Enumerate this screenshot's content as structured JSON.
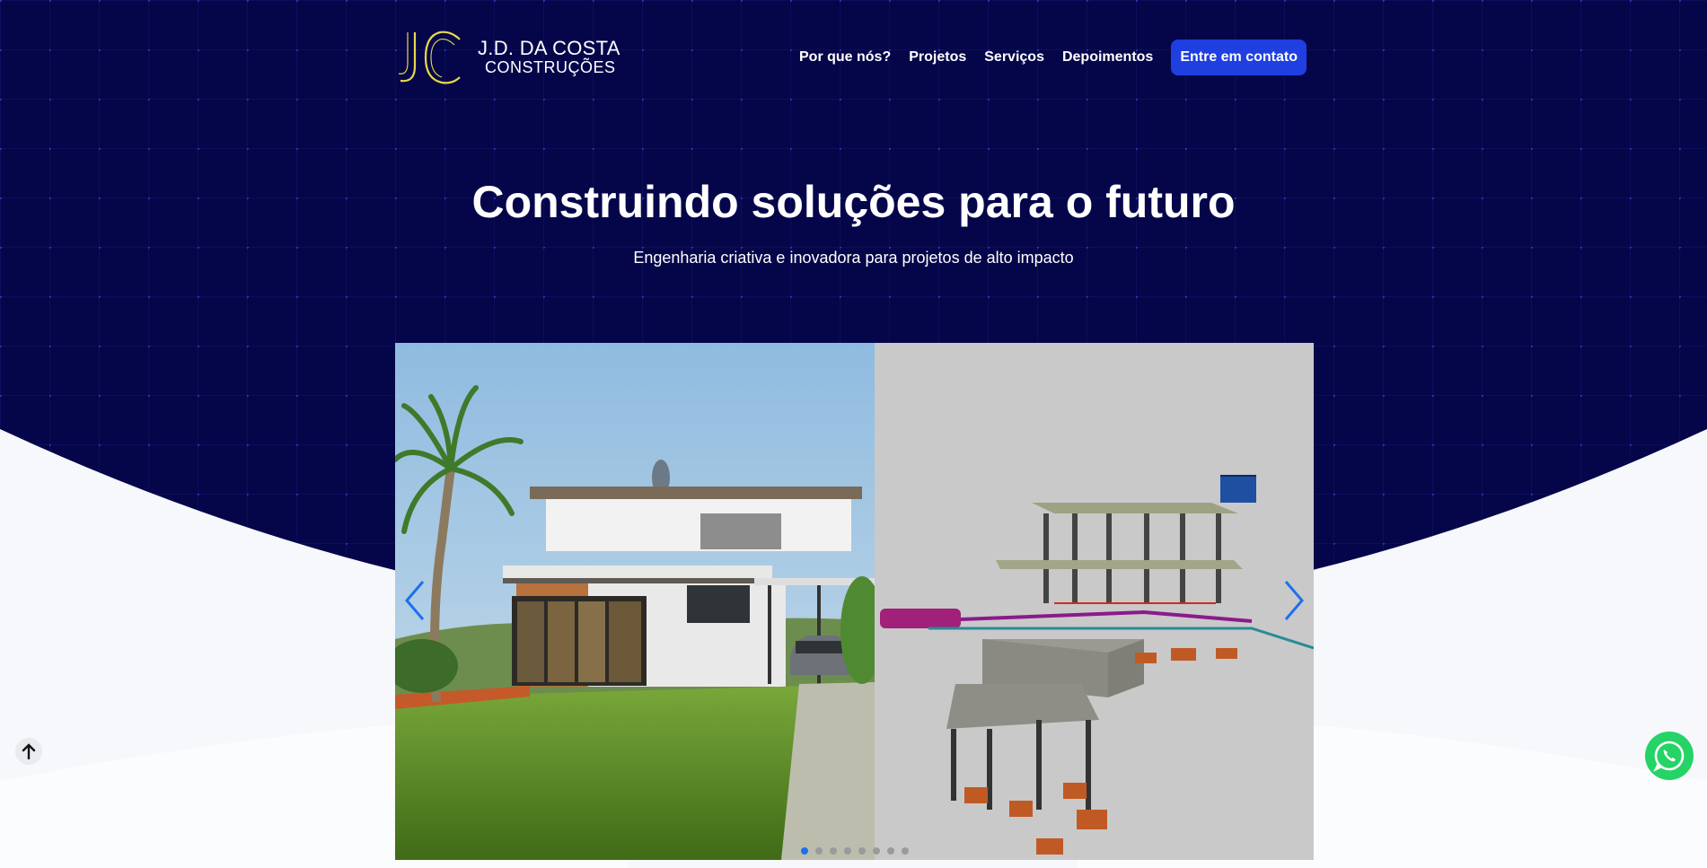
{
  "brand": {
    "name": "J.D. DA COSTA",
    "subtitle": "CONSTRUÇÕES",
    "monogram": "JC",
    "gold": "#e8d84a"
  },
  "nav": {
    "items": [
      {
        "label": "Por que nós?"
      },
      {
        "label": "Projetos"
      },
      {
        "label": "Serviços"
      },
      {
        "label": "Depoimentos"
      }
    ],
    "cta_label": "Entre em contato"
  },
  "hero": {
    "title": "Construindo soluções para o futuro",
    "subtitle": "Engenharia criativa e inovadora para projetos de alto impacto"
  },
  "carousel": {
    "slide_count": 8,
    "active_index": 0,
    "left_image": "modern-house-render",
    "right_image": "3d-structural-model"
  },
  "colors": {
    "hero_bg": "#05064a",
    "grid_dot": "#4b3ce0",
    "cta_bg": "#1f3fe0",
    "dot_active": "#1e6ff0",
    "arrow": "#1e6ff0",
    "whatsapp": "#25d366"
  },
  "icons": {
    "scroll_top": "arrow-up-icon",
    "whatsapp": "whatsapp-icon",
    "prev": "chevron-left-icon",
    "next": "chevron-right-icon"
  }
}
